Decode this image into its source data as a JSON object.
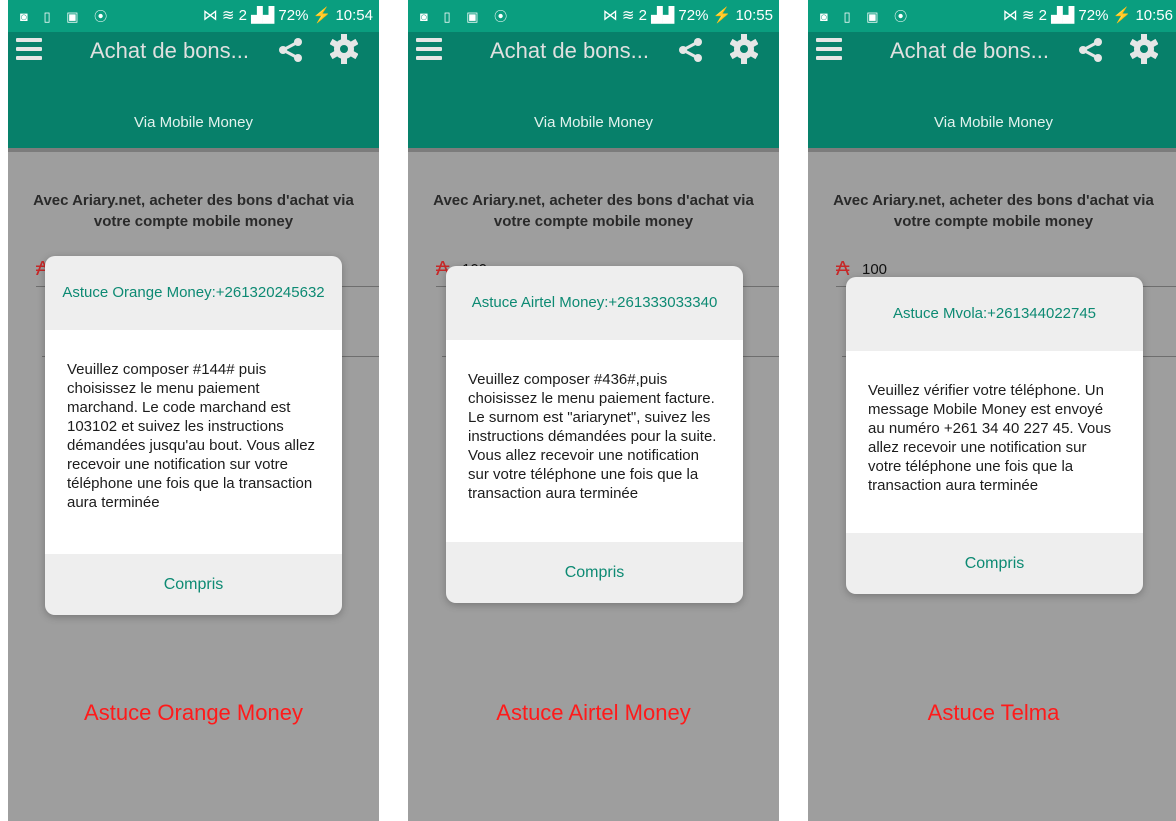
{
  "panels": [
    {
      "status": {
        "icons_left": "◙ ▯ ▣ ⦿",
        "signal": "⋈ ≋ 2 ▟▟",
        "battery": "72%",
        "time": "10:54"
      },
      "app_title": "Achat de bons...",
      "subtitle": "Via Mobile Money",
      "intro": "Avec Ariary.net, acheter des bons d'achat via votre compte mobile money",
      "amount": "",
      "dialog": {
        "title": "Astuce Orange Money:+261320245632",
        "body": "Veuillez composer #144# puis choisissez le menu paiement marchand. Le code marchand est 103102 et suivez les instructions démandées jusqu'au bout. Vous allez recevoir une notification sur votre téléphone une fois que la transaction aura terminée",
        "button": "Compris"
      },
      "caption": "Astuce Orange Money"
    },
    {
      "status": {
        "icons_left": "◙ ▯ ▣ ⦿",
        "signal": "⋈ ≋ 2 ▟▟",
        "battery": "72%",
        "time": "10:55"
      },
      "app_title": "Achat de bons...",
      "subtitle": "Via Mobile Money",
      "intro": "Avec Ariary.net, acheter des bons d'achat via votre compte mobile money",
      "amount": "100",
      "dialog": {
        "title": "Astuce Airtel Money:+261333033340",
        "body": "Veuillez composer #436#,puis choisissez le menu paiement facture. Le surnom est \"ariarynet\", suivez les instructions démandées pour la suite. Vous allez recevoir une notification sur votre téléphone une fois que la transaction aura terminée",
        "button": "Compris"
      },
      "caption": "Astuce Airtel Money"
    },
    {
      "status": {
        "icons_left": "◙ ▯ ▣ ⦿",
        "signal": "⋈ ≋ 2 ▟▟",
        "battery": "72%",
        "time": "10:56"
      },
      "app_title": "Achat de bons...",
      "subtitle": "Via Mobile Money",
      "intro": "Avec Ariary.net, acheter des bons d'achat via votre compte mobile money",
      "amount": "100",
      "dialog": {
        "title": "Astuce Mvola:+261344022745",
        "body": "Veuillez vérifier votre téléphone. Un message Mobile Money est envoyé au numéro +261 34 40 227 45. Vous allez recevoir une notification sur votre téléphone une fois que la transaction aura terminée",
        "button": "Compris"
      },
      "caption": "Astuce Telma"
    }
  ],
  "icons": {
    "menu": "hamburger-icon",
    "share": "share-icon",
    "settings": "gear-icon",
    "currency": "ariary-icon"
  },
  "colors": {
    "statusbar": "#0a9e7f",
    "toolbar": "#07806a",
    "accent_text": "#0d8a73",
    "caption": "#ff1a1a",
    "scrim": "#9e9e9e"
  }
}
